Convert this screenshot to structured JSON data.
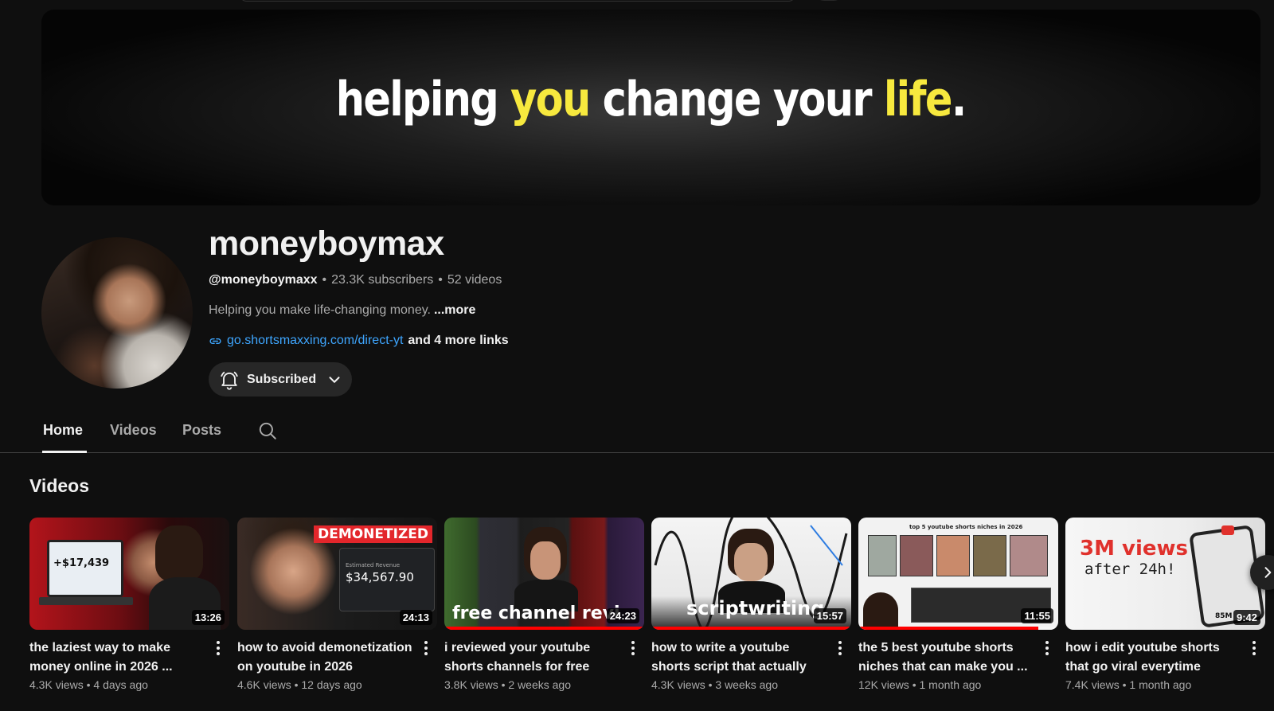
{
  "banner": {
    "words": [
      "helping",
      "you",
      "change your",
      "life",
      "."
    ]
  },
  "channel": {
    "name": "moneyboymax",
    "handle": "@moneyboymaxx",
    "subscribers": "23.3K subscribers",
    "video_count": "52 videos",
    "description": "Helping you make life-changing money.",
    "more_label": "...more",
    "link": "go.shortsmaxxing.com/direct-yt",
    "more_links": "and 4 more links",
    "subscribe_label": "Subscribed"
  },
  "tabs": [
    {
      "label": "Home",
      "active": true
    },
    {
      "label": "Videos",
      "active": false
    },
    {
      "label": "Posts",
      "active": false
    }
  ],
  "shelf": {
    "title": "Videos",
    "videos": [
      {
        "title": "the laziest way to make money online in 2026 ...",
        "views": "4.3K views",
        "age": "4 days ago",
        "duration": "13:26",
        "thumb_text": "+$17,439"
      },
      {
        "title": "how to avoid demonetization on youtube in 2026",
        "views": "4.6K views",
        "age": "12 days ago",
        "duration": "24:13",
        "thumb_text": "DEMONETIZED",
        "thumb_text2": "$34,567.90",
        "thumb_text3": "Estimated Revenue"
      },
      {
        "title": "i reviewed your youtube shorts channels for free",
        "views": "3.8K views",
        "age": "2 weeks ago",
        "duration": "24:23",
        "thumb_text": "free channel revi"
      },
      {
        "title": "how to write a youtube shorts script that actually goes viral",
        "views": "4.3K views",
        "age": "3 weeks ago",
        "duration": "15:57",
        "thumb_text": "scriptwriting"
      },
      {
        "title": "the 5 best youtube shorts niches that can make you ...",
        "views": "12K views",
        "age": "1 month ago",
        "duration": "11:55",
        "thumb_text": "top 5 youtube shorts niches in 2026"
      },
      {
        "title": "how i edit youtube shorts that go viral everytime",
        "views": "7.4K views",
        "age": "1 month ago",
        "duration": "9:42",
        "thumb_text": "3M views",
        "thumb_text2": "after 24h!",
        "thumb_text3": "85M"
      }
    ]
  },
  "separator": "•"
}
